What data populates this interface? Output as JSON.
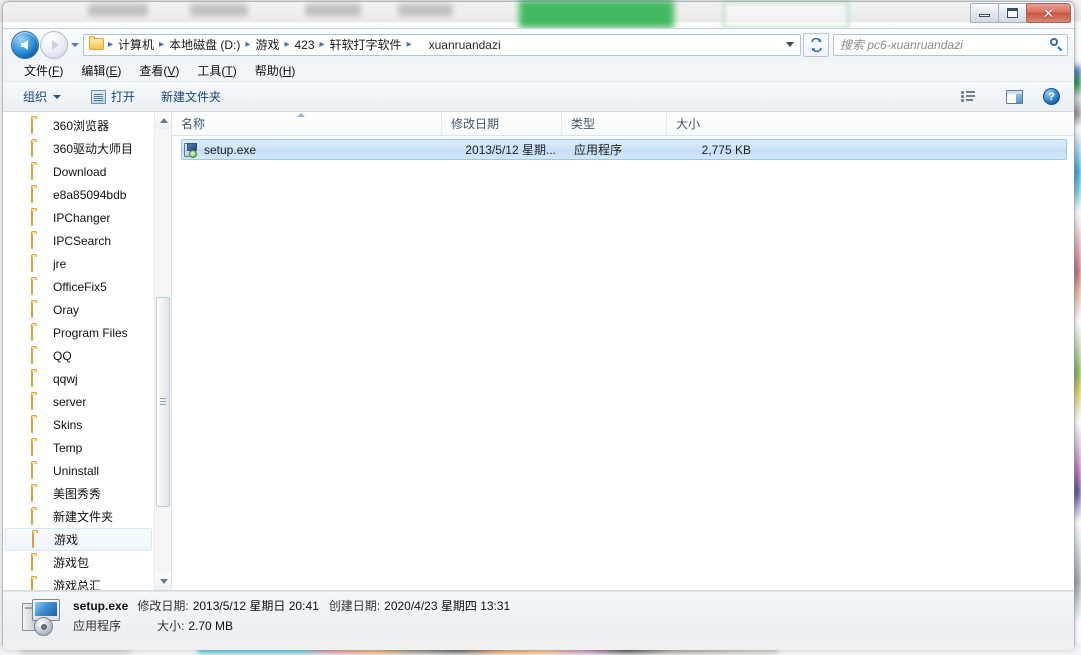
{
  "window": {
    "controls": {
      "minimize": "–",
      "maximize": "❐",
      "close": "✕"
    }
  },
  "address": {
    "back_tooltip": "后退",
    "forward_tooltip": "前进",
    "breadcrumbs": [
      "计算机",
      "本地磁盘 (D:)",
      "游戏",
      "423",
      "轩软打字软件",
      "xuanruandazi"
    ],
    "separator": "▸"
  },
  "search": {
    "placeholder": "搜索 pc6-xuanruandazi"
  },
  "menubar": [
    {
      "text": "文件(",
      "key": "F",
      "tail": ")"
    },
    {
      "text": "编辑(",
      "key": "E",
      "tail": ")"
    },
    {
      "text": "查看(",
      "key": "V",
      "tail": ")"
    },
    {
      "text": "工具(",
      "key": "T",
      "tail": ")"
    },
    {
      "text": "帮助(",
      "key": "H",
      "tail": ")"
    }
  ],
  "commandbar": {
    "organize": "组织",
    "open": "打开",
    "new_folder": "新建文件夹",
    "help_glyph": "?"
  },
  "navpane": {
    "items": [
      {
        "label": "360浏览器",
        "selected": false
      },
      {
        "label": "360驱动大师目",
        "selected": false
      },
      {
        "label": "Download",
        "selected": false
      },
      {
        "label": "e8a85094bdb",
        "selected": false
      },
      {
        "label": "IPChanger",
        "selected": false
      },
      {
        "label": "IPCSearch",
        "selected": false
      },
      {
        "label": "jre",
        "selected": false
      },
      {
        "label": "OfficeFix5",
        "selected": false
      },
      {
        "label": "Oray",
        "selected": false
      },
      {
        "label": "Program Files",
        "selected": false
      },
      {
        "label": "QQ",
        "selected": false
      },
      {
        "label": "qqwj",
        "selected": false
      },
      {
        "label": "server",
        "selected": false
      },
      {
        "label": "Skins",
        "selected": false
      },
      {
        "label": "Temp",
        "selected": false
      },
      {
        "label": "Uninstall",
        "selected": false
      },
      {
        "label": "美图秀秀",
        "selected": false
      },
      {
        "label": "新建文件夹",
        "selected": false
      },
      {
        "label": "游戏",
        "selected": true
      },
      {
        "label": "游戏包",
        "selected": false
      },
      {
        "label": "游戏总汇",
        "selected": false
      }
    ]
  },
  "filelist": {
    "columns": [
      {
        "label": "名称"
      },
      {
        "label": "修改日期"
      },
      {
        "label": "类型"
      },
      {
        "label": "大小"
      }
    ],
    "rows": [
      {
        "name": "setup.exe",
        "date": "2013/5/12 星期...",
        "type": "应用程序",
        "size": "2,775 KB",
        "selected": true
      }
    ]
  },
  "details": {
    "name": "setup.exe",
    "modified_label": "修改日期:",
    "modified_value": "2013/5/12 星期日 20:41",
    "created_label": "创建日期:",
    "created_value": "2020/4/23 星期四 13:31",
    "type": "应用程序",
    "size_label": "大小:",
    "size_value": "2.70 MB"
  }
}
